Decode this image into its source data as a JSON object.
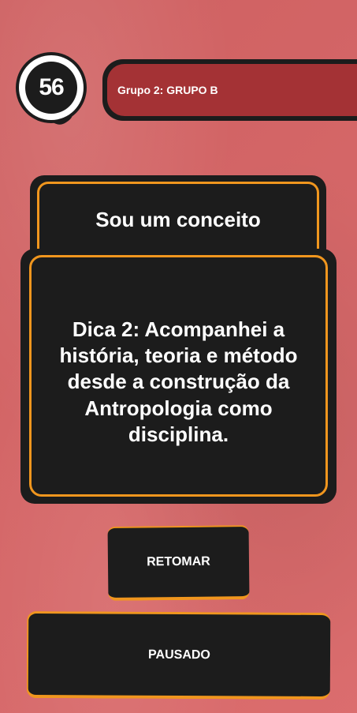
{
  "timer": {
    "value": "56"
  },
  "group": {
    "label": "Grupo 2: GRUPO B"
  },
  "category": {
    "title": "Sou um conceito"
  },
  "clue": {
    "text": "Dica 2: Acompanhei a história, teoria e método desde a construção da Antropologia como disciplina."
  },
  "buttons": {
    "resume_label": "RETOMAR",
    "paused_label": "PAUSADO"
  },
  "colors": {
    "background": "#d96566",
    "card": "#1c1c1c",
    "accent": "#f0961e",
    "banner": "#a43235",
    "text": "#ffffff"
  }
}
